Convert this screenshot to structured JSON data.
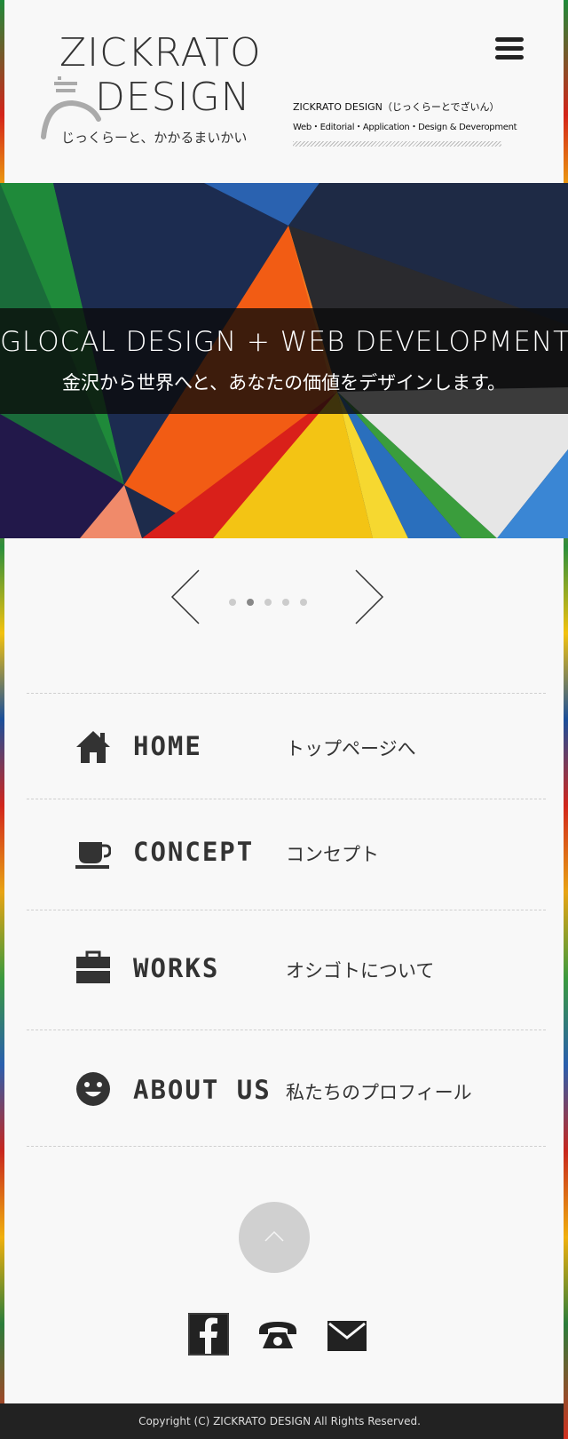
{
  "header": {
    "logo_line1": "ZICKRATO",
    "logo_line2": "DESIGN",
    "logo_tagline": "じっくらーと、かかるまいかい",
    "info_name": "ZICKRATO DESIGN（じっくらーとでざいん）",
    "info_sub": "Web・Editorial・Application・Design & Deveropment",
    "menu_icon": "hamburger-menu-icon"
  },
  "hero": {
    "title": "GLOCAL DESIGN + WEB DEVELOPMENT",
    "subtitle": "金沢から世界へと、あなたの価値をデザインします。"
  },
  "slider": {
    "prev_icon": "chevron-left-icon",
    "next_icon": "chevron-right-icon",
    "dot_count": 5,
    "active_index": 1
  },
  "nav": {
    "items": [
      {
        "label": "HOME",
        "desc": "トップページへ",
        "icon": "home-icon"
      },
      {
        "label": "CONCEPT",
        "desc": "コンセプト",
        "icon": "cup-icon"
      },
      {
        "label": "WORKS",
        "desc": "オシゴトについて",
        "icon": "briefcase-icon"
      },
      {
        "label": "ABOUT US",
        "desc": "私たちのプロフィール",
        "icon": "smiley-icon"
      }
    ]
  },
  "back_to_top_icon": "chevron-up-icon",
  "social": {
    "facebook_icon": "facebook-icon",
    "phone_icon": "telephone-icon",
    "mail_icon": "mail-icon"
  },
  "footer": {
    "copyright": "Copyright (C) ZICKRATO DESIGN  All Rights Reserved."
  },
  "colors": {
    "page_bg": "#f8f8f8",
    "text": "#333333",
    "footer_bg": "#222222"
  }
}
